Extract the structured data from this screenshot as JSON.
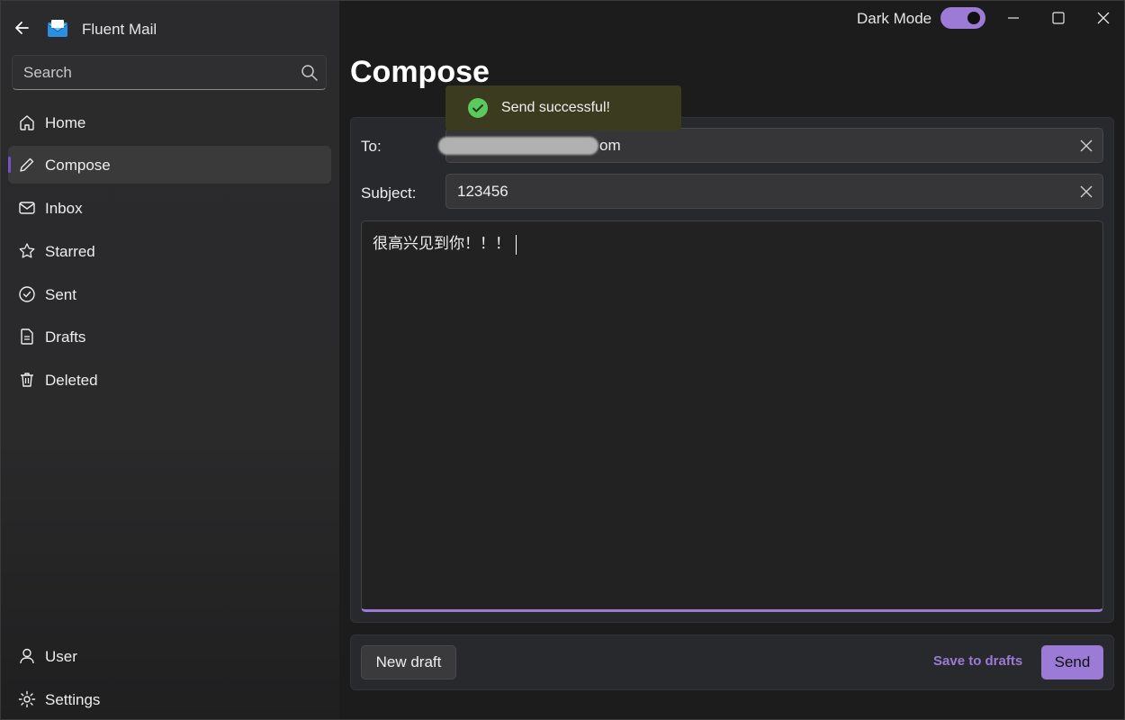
{
  "app": {
    "title": "Fluent Mail",
    "dark_mode_label": "Dark Mode",
    "dark_mode_on": true,
    "accent": "#9b7bd6"
  },
  "search": {
    "placeholder": "Search",
    "icon": "search-icon"
  },
  "sidebar": {
    "items": [
      {
        "label": "Home",
        "icon": "home-icon",
        "selected": false
      },
      {
        "label": "Compose",
        "icon": "pencil-icon",
        "selected": true
      },
      {
        "label": "Inbox",
        "icon": "mail-icon",
        "selected": false
      },
      {
        "label": "Starred",
        "icon": "star-icon",
        "selected": false
      },
      {
        "label": "Sent",
        "icon": "check-circle-icon",
        "selected": false
      },
      {
        "label": "Drafts",
        "icon": "document-icon",
        "selected": false
      },
      {
        "label": "Deleted",
        "icon": "trash-icon",
        "selected": false
      }
    ],
    "footer": [
      {
        "label": "User",
        "icon": "user-icon"
      },
      {
        "label": "Settings",
        "icon": "gear-icon"
      }
    ]
  },
  "compose": {
    "title": "Compose",
    "to_label": "To:",
    "to_value_visible": "om",
    "subject_label": "Subject:",
    "subject_value": "123456",
    "body": "很高兴见到你！！！"
  },
  "toast": {
    "message": "Send successful!",
    "status": "success"
  },
  "actions": {
    "new_draft": "New draft",
    "save_to_drafts": "Save to drafts",
    "send": "Send"
  }
}
